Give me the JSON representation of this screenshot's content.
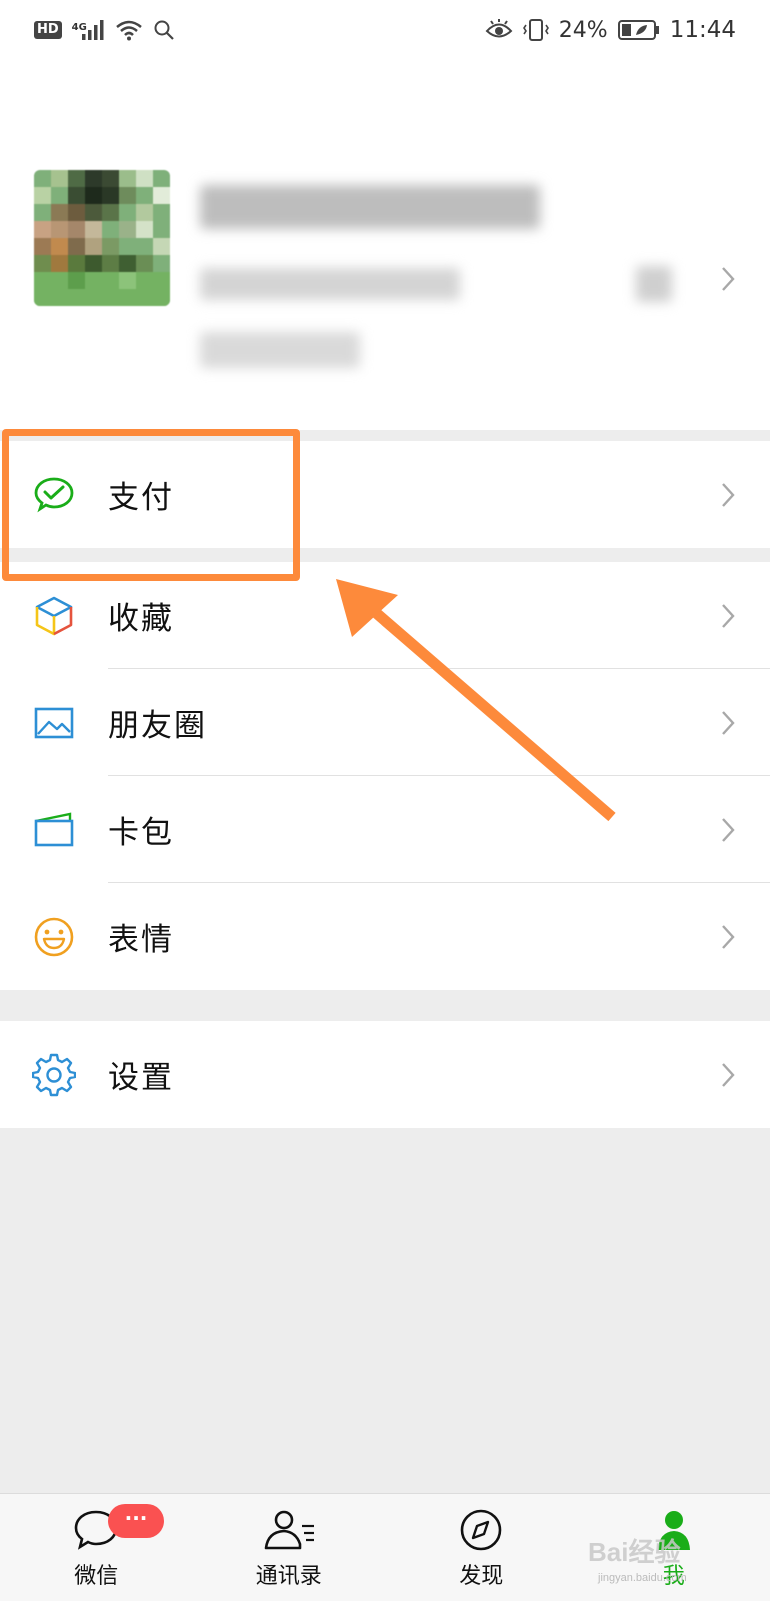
{
  "status_bar": {
    "hd": "HD",
    "network": "4G",
    "battery": "24%",
    "time": "11:44"
  },
  "menu": {
    "pay": "支付",
    "favorites": "收藏",
    "moments": "朋友圈",
    "cards": "卡包",
    "stickers": "表情",
    "settings": "设置"
  },
  "tabs": {
    "chats": "微信",
    "contacts": "通讯录",
    "discover": "发现",
    "me": "我",
    "chats_badge": "···"
  },
  "colors": {
    "accent_green": "#1aad19",
    "highlight_orange": "#fd8a3b",
    "badge_red": "#fa5151"
  },
  "watermark": {
    "brand": "Bai经验",
    "site": "jingyan.baidu.com"
  }
}
